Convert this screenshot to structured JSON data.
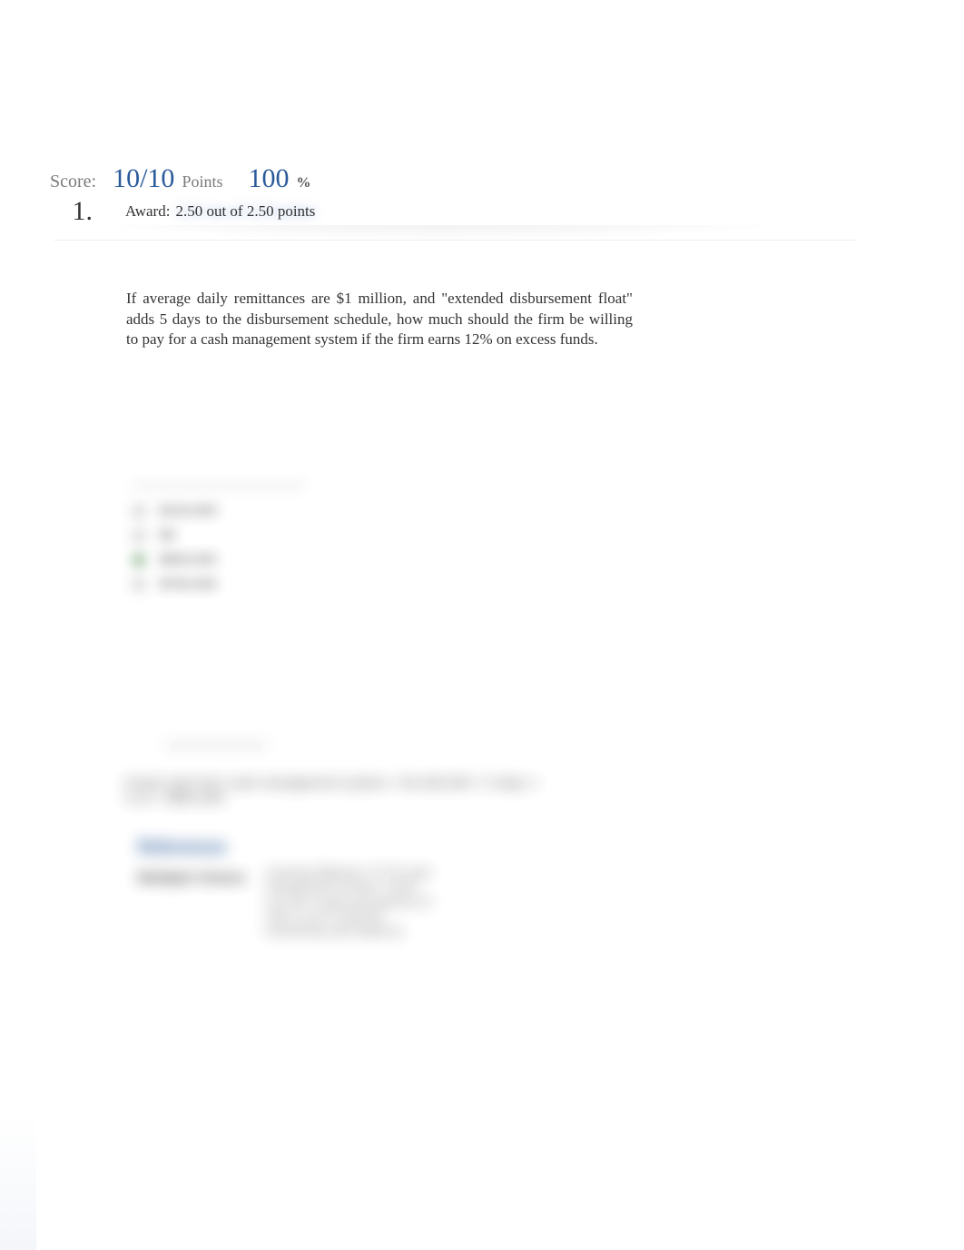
{
  "score": {
    "label": "Score:",
    "ratio": "10/10",
    "points_label": "Points",
    "percent": "100",
    "percent_symbol": "%"
  },
  "question": {
    "number": "1.",
    "award_label": "Award:",
    "award_value": "2.50 out of 2.50 points",
    "text": "If average daily remittances are $1 million, and \"extended disbursement float\" adds 5 days to the disbursement schedule, how much should the firm be willing to pay for a cash management system if the firm earns 12% on excess funds."
  },
  "options": [
    {
      "label": "$120,000",
      "selected": false
    },
    {
      "label": "$0",
      "selected": false
    },
    {
      "label": "$600,000",
      "selected": true
    },
    {
      "label": "$700,000",
      "selected": false
    }
  ],
  "explanation": {
    "formula": "Freed cash from cash management system = $1,000,000 × 5 days × 0.12 = $600,000",
    "reference_label": "References",
    "mc_label": "Multiple Choice",
    "mc_meta": "Learning Objective: 07-03 Cash management involves control over the receipt and payment of cash so as to minimize nonearning cash balances."
  }
}
